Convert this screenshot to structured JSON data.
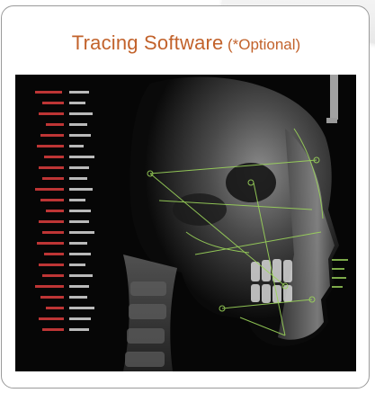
{
  "card": {
    "title_main": "Tracing Software",
    "title_sub": "(*Optional)"
  },
  "image": {
    "icon": "cephalometric-xray-tracing",
    "colors": {
      "title": "#c2622b",
      "tracing_lines": "#9bd45a",
      "labels_red": "#d23b3b",
      "labels_white": "#e8e8e8"
    }
  }
}
